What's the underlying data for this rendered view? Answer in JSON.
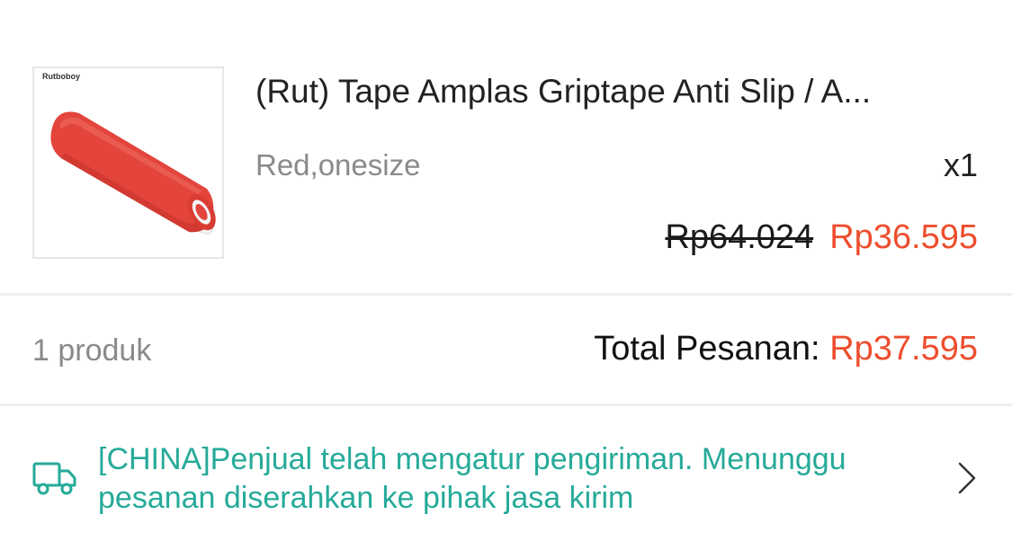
{
  "product": {
    "thumbnail_brand": "Rutboboy",
    "title": "(Rut) Tape Amplas Griptape Anti Slip / A...",
    "variant": "Red,onesize",
    "quantity": "x1",
    "original_price": "Rp64.024",
    "sale_price": "Rp36.595"
  },
  "summary": {
    "product_count": "1 produk",
    "total_label": "Total Pesanan: ",
    "total_value": "Rp37.595"
  },
  "shipping": {
    "status": "[CHINA]Penjual telah mengatur pengiriman. Menunggu pesanan diserahkan ke pihak jasa kirim",
    "icon": "truck-icon"
  },
  "colors": {
    "price_accent": "#ee4d2d",
    "shipping_text": "#26aa99",
    "product_color": "#e3443b"
  }
}
